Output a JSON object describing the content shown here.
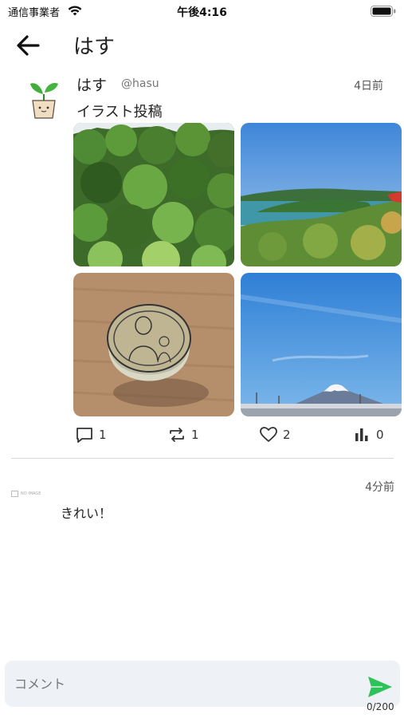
{
  "status_bar": {
    "carrier": "通信事業者",
    "time": "午後4:16"
  },
  "header": {
    "title": "はす"
  },
  "post": {
    "display_name": "はす",
    "handle": "@hasu",
    "timestamp": "4日前",
    "text": "イラスト投稿",
    "actions": {
      "replies": "1",
      "reposts": "1",
      "likes": "2",
      "views": "0"
    }
  },
  "comment": {
    "avatar_placeholder": "NO IMAGE",
    "timestamp": "4分前",
    "text": "きれい！"
  },
  "composer": {
    "placeholder": "コメント",
    "counter": "0/200"
  },
  "colors": {
    "send": "#2ec25a",
    "divider": "#d9d9d9",
    "composer_bg": "#eef1f5"
  },
  "icons": {
    "back": "arrow-left-icon",
    "reply": "comment-bubble-icon",
    "repost": "repost-icon",
    "like": "heart-icon",
    "views": "bar-chart-icon",
    "send": "send-icon"
  }
}
